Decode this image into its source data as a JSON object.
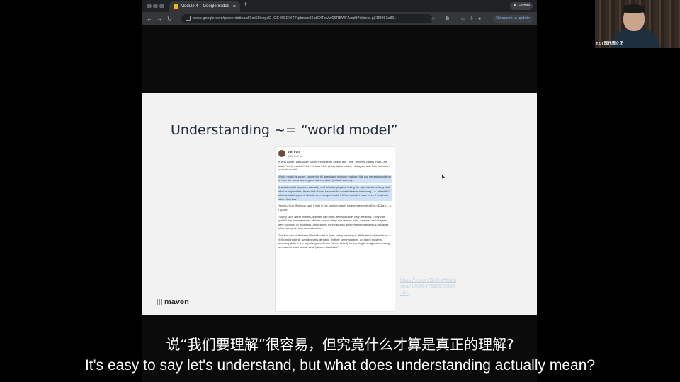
{
  "browser": {
    "tab_title": "Module 4 – Google Slides",
    "tab_close": "×",
    "new_tab": "+",
    "gemini_label": "✦ Gemini",
    "url": "docs.google.com/presentation/d/1mSHxxgcD-jOE46EElXT7qdmiox86atEXFsVw66RBWFA/edit?slideid.g31f8063c89...",
    "relaunch_label": "Relaunch to update",
    "nav": {
      "back": "←",
      "forward": "→",
      "reload": "↻",
      "home": "⌂"
    },
    "icons": [
      "star-icon",
      "extensions-icon",
      "sidepanel-icon",
      "download-icon",
      "profile-icon"
    ]
  },
  "slide": {
    "title": "Understanding ~= “world model”",
    "brand": "maven",
    "side_link": "https://x.com/DrJimFan/status/1709947595525095787",
    "tweet": {
      "author": "Jim Fan",
      "handle": "@DrJimFan",
      "p1": "A viral paper \"Language Model Represents Space and Time\" recently claims that LLMs learn \"world models\". As much as I like @tegmark's works, I disagree with their definition of world model.",
      "p2": "World model is a core concept in AI agent and decision making. It is our mental simulation of how the world works given interventions (or lack thereof).",
      "p3": "A world model captures causality and intuitive physics, telling the agent what is likely and what is impossible. It can and should be used for counterfactual reasoning, i.e. \"what ifs\": what would happen if I knock over a cup of water? Where would I have been if I had not taken that bus?",
      "p4": "Yann LeCun @ylecun says it well in his position paper (openreview.net/pdf?id=BZ5a1r-...), I quote:",
      "p5": "\"Using such world models, animals can learn new skills with very few trials. They can predict the consequences of their actions, they can reason, plan, explore, and imagine new solutions to problems. Importantly, they can also avoid making dangerous mistakes when facing an unknown situation.\"",
      "p6": "The first use of the term World Model in deep policy learning is attributed to @hardmaru & @SchmidhuberAI: worldmodels.github.io. In their seminal paper, an agent masters shooting skills in the popular game Doom (demo below) by learning in imagination, using an internal world model as a \"physics simulator\"."
    }
  },
  "webcam": {
    "label": "YZ | 现代表立正"
  },
  "captions": {
    "zh": "说“我们要理解”很容易，但究竟什么才算是真正的理解?",
    "en": "It's easy to say let's understand, but what does understanding actually mean?"
  }
}
